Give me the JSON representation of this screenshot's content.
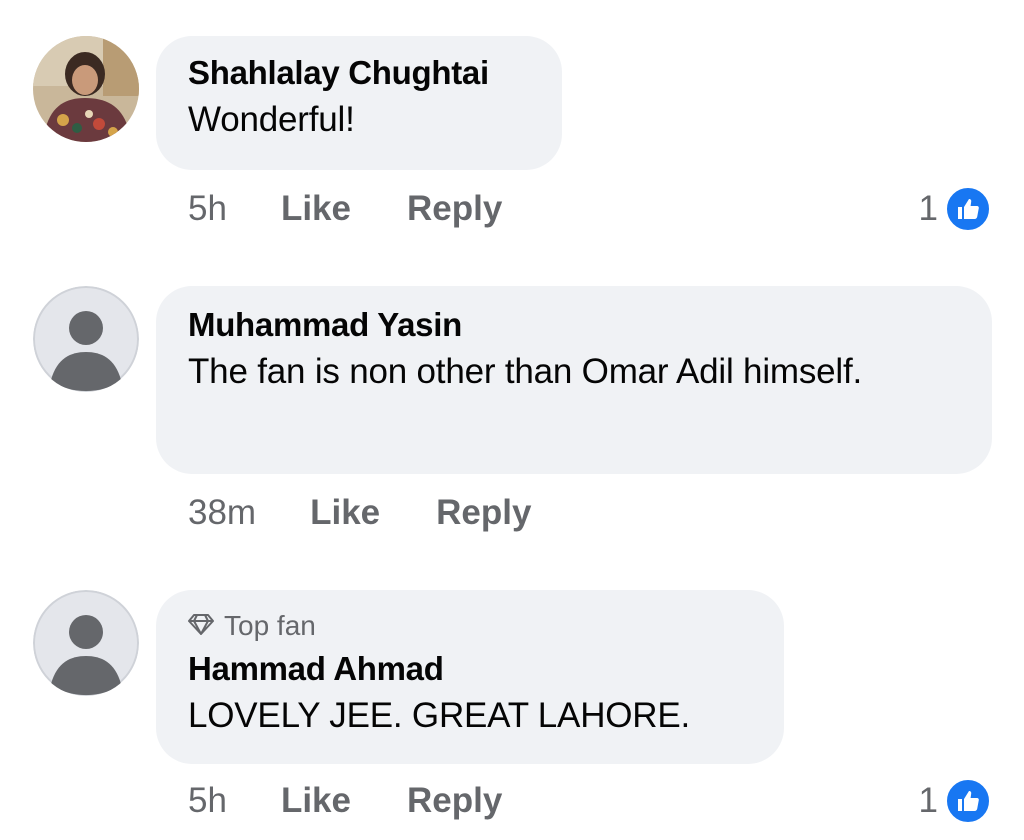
{
  "comments": [
    {
      "author": "Shahlalay Chughtai",
      "text": "Wonderful!",
      "time": "5h",
      "like_label": "Like",
      "reply_label": "Reply",
      "reaction_count": "1",
      "avatar": "profile-photo"
    },
    {
      "author": "Muhammad Yasin",
      "text": "The fan is non other than Omar Adil himself.",
      "time": "38m",
      "like_label": "Like",
      "reply_label": "Reply",
      "avatar": "default-silhouette"
    },
    {
      "badge": "Top fan",
      "badge_icon": "diamond-icon",
      "author": "Hammad Ahmad",
      "text": "LOVELY JEE. GREAT LAHORE.",
      "time": "5h",
      "like_label": "Like",
      "reply_label": "Reply",
      "reaction_count": "1",
      "avatar": "default-silhouette"
    }
  ],
  "colors": {
    "bubble": "#f0f2f5",
    "meta_text": "#65676b",
    "like_blue": "#1877f2"
  }
}
